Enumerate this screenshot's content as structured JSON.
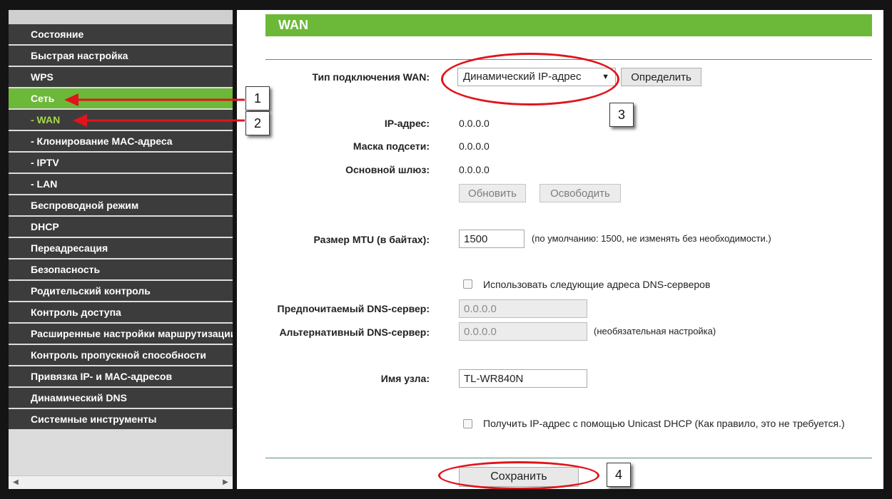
{
  "sidebar": {
    "items": [
      {
        "label": "Состояние",
        "state": ""
      },
      {
        "label": "Быстрая настройка",
        "state": ""
      },
      {
        "label": "WPS",
        "state": ""
      },
      {
        "label": "Сеть",
        "state": "active"
      },
      {
        "label": "- WAN",
        "state": "sub-active"
      },
      {
        "label": "- Клонирование MAC-адреса",
        "state": ""
      },
      {
        "label": "- IPTV",
        "state": ""
      },
      {
        "label": "- LAN",
        "state": ""
      },
      {
        "label": "Беспроводной режим",
        "state": ""
      },
      {
        "label": "DHCP",
        "state": ""
      },
      {
        "label": "Переадресация",
        "state": ""
      },
      {
        "label": "Безопасность",
        "state": ""
      },
      {
        "label": "Родительский контроль",
        "state": ""
      },
      {
        "label": "Контроль доступа",
        "state": ""
      },
      {
        "label": "Расширенные настройки маршрутизации",
        "state": ""
      },
      {
        "label": "Контроль пропускной способности",
        "state": ""
      },
      {
        "label": "Привязка IP- и MAC-адресов",
        "state": ""
      },
      {
        "label": "Динамический DNS",
        "state": ""
      },
      {
        "label": "Системные инструменты",
        "state": ""
      }
    ],
    "scroll_left": "◀",
    "scroll_right": "▶"
  },
  "main": {
    "header": "WAN",
    "connection_type_label": "Тип подключения WAN:",
    "connection_type_value": "Динамический IP-адрес",
    "select_caret": "▼",
    "detect_button": "Определить",
    "ip_label": "IP-адрес:",
    "ip_value": "0.0.0.0",
    "mask_label": "Маска подсети:",
    "mask_value": "0.0.0.0",
    "gateway_label": "Основной шлюз:",
    "gateway_value": "0.0.0.0",
    "renew_button": "Обновить",
    "release_button": "Освободить",
    "mtu_label": "Размер MTU (в байтах):",
    "mtu_value": "1500",
    "mtu_note": "(по умолчанию: 1500, не изменять без необходимости.)",
    "use_dns_label": "Использовать следующие адреса DNS-серверов",
    "primary_dns_label": "Предпочитаемый DNS-сервер:",
    "primary_dns_value": "0.0.0.0",
    "secondary_dns_label": "Альтернативный DNS-сервер:",
    "secondary_dns_value": "0.0.0.0",
    "secondary_dns_note": "(необязательная настройка)",
    "host_label": "Имя узла:",
    "host_value": "TL-WR840N",
    "unicast_label": "Получить IP-адрес с помощью Unicast DHCP (Как правило, это не требуется.)",
    "save_button": "Сохранить"
  },
  "callouts": [
    "1",
    "2",
    "3",
    "4"
  ],
  "colors": {
    "accent_green": "#6cb838",
    "sidebar_item_bg": "#3c3c3c",
    "annotation_red": "#e0141c"
  }
}
